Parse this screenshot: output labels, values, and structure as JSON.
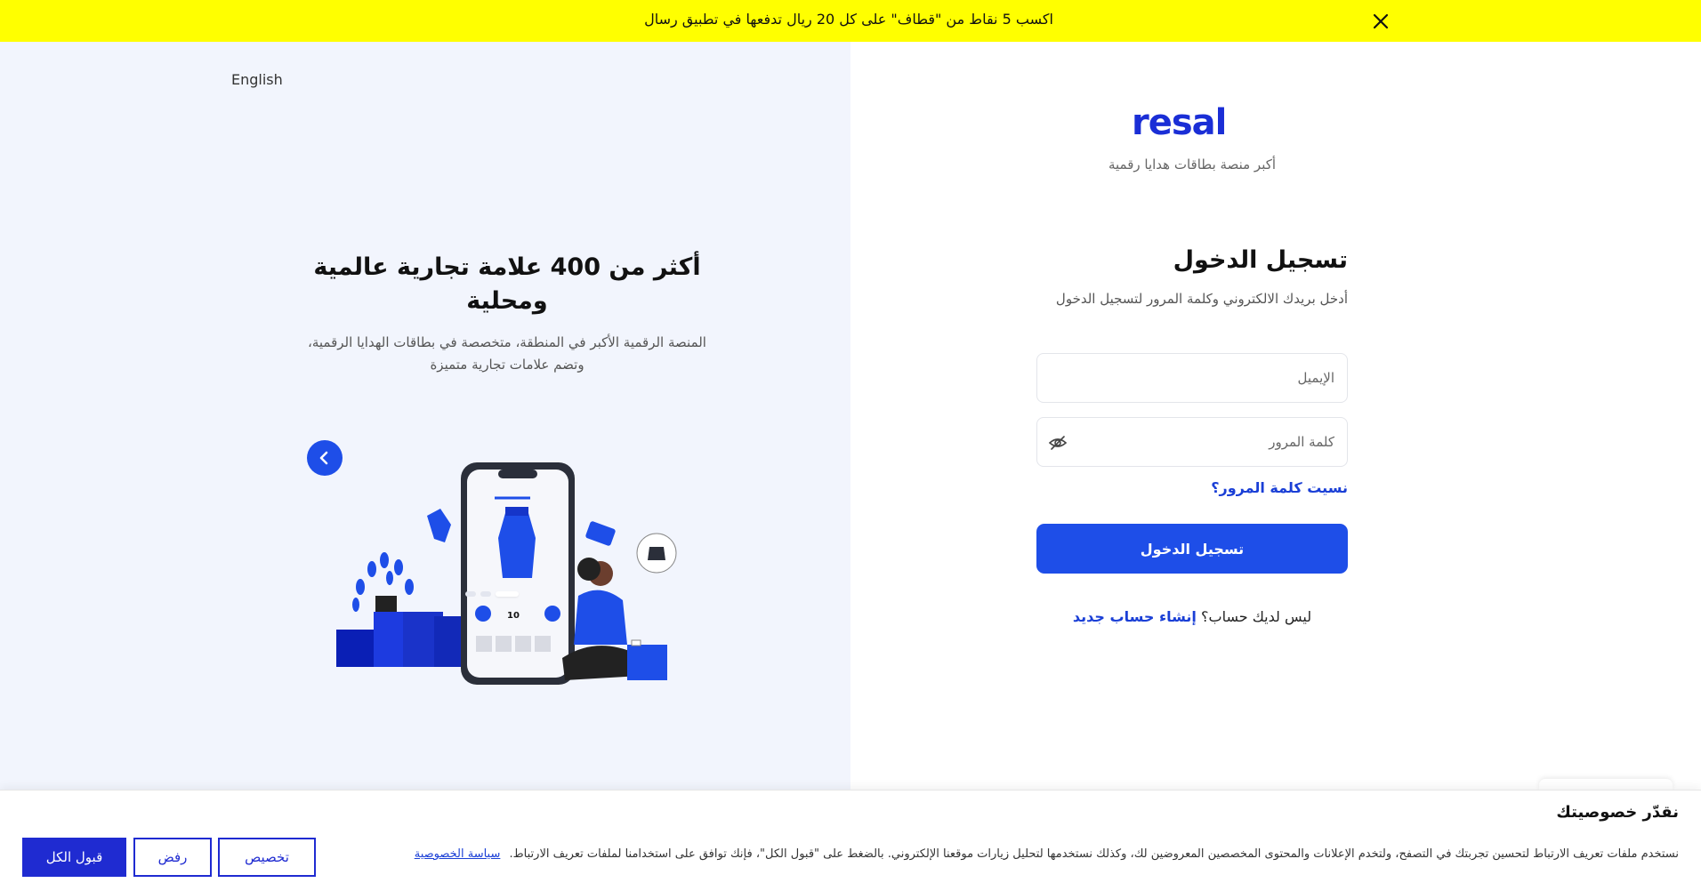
{
  "promo": {
    "text": "اكسب 5 نقاط من \"قطاف\" على كل 20 ريال تدفعها في تطبيق رسال",
    "close_icon": "close-icon"
  },
  "left": {
    "language_link": "English",
    "slide_title": "أكثر من 400 علامة تجارية عالمية ومحلية",
    "slide_subtitle": "المنصة الرقمية الأكبر في المنطقة، متخصصة في بطاقات الهدايا الرقمية، وتضم علامات تجارية متميزة",
    "arrow_icon": "chevron-left-icon",
    "dots_count": 3,
    "active_dot": 3
  },
  "brand": {
    "logo_text": "resal",
    "tagline": "أكبر منصة بطاقات هدايا رقمية",
    "accent_color": "#1e4ee8"
  },
  "login": {
    "title": "تسجيل الدخول",
    "subtitle": "أدخل بريدك الالكتروني وكلمة المرور لتسجيل الدخول",
    "email_placeholder": "الإيميل",
    "password_placeholder": "كلمة المرور",
    "eye_icon": "eye-off-icon",
    "forgot_link": "نسيت كلمة المرور؟",
    "submit_label": "تسجيل الدخول",
    "no_account_text": "ليس لديك حساب؟",
    "signup_link": "إنشاء حساب جديد"
  },
  "cookie": {
    "title": "نقدّر خصوصيتك",
    "text": "نستخدم ملفات تعريف الارتباط لتحسين تجربتك في التصفح، ولتخدم الإعلانات والمحتوى المخصصين المعروضين لك، وكذلك نستخدمها لتحليل زيارات موقعنا الإلكتروني. بالضغط على \"قبول الكل\"، فإنك توافق على استخدامنا لملفات تعريف الارتباط.",
    "policy_link": "سياسة الخصوصية",
    "customize_label": "تخصيص",
    "reject_label": "رفض",
    "accept_label": "قبول الكل"
  }
}
